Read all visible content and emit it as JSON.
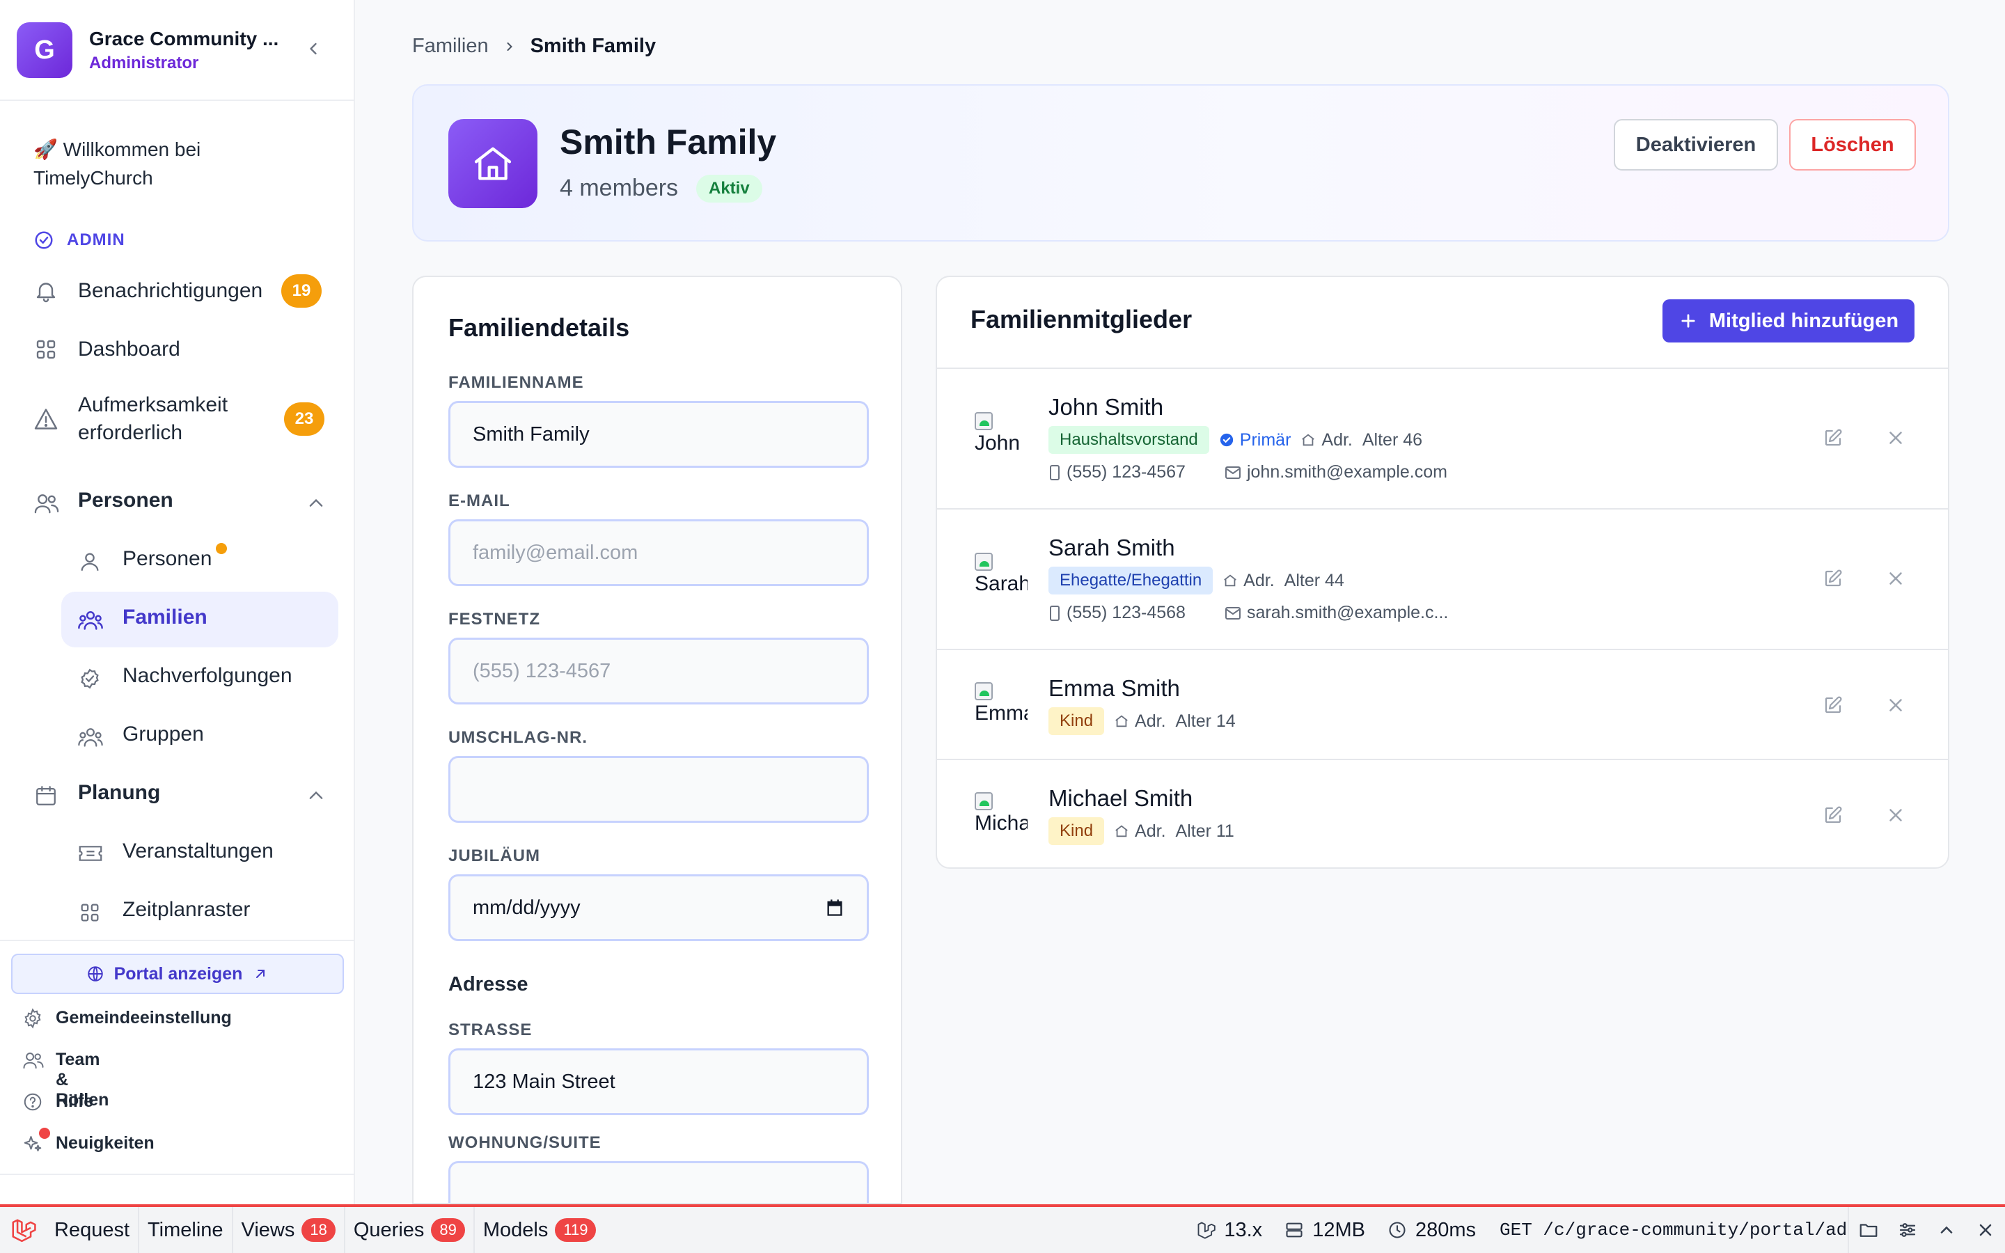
{
  "sidebar": {
    "org_initial": "G",
    "org_name": "Grace Community ...",
    "org_role": "Administrator",
    "welcome": "🚀 Willkommen bei TimelyChurch",
    "section_admin": "ADMIN",
    "notifications": {
      "label": "Benachrichtigungen",
      "count": "19"
    },
    "dashboard": "Dashboard",
    "attention": {
      "label": "Aufmerksamkeit erforderlich",
      "count": "23"
    },
    "personen_group": "Personen",
    "personen_items": [
      "Personen",
      "Familien",
      "Nachverfolgungen",
      "Gruppen"
    ],
    "planung_group": "Planung",
    "planung_items": [
      "Veranstaltungen",
      "Zeitplanraster"
    ],
    "portal_button": "Portal anzeigen",
    "footer": [
      "Gemeindeeinstellung",
      "Team & Rollen",
      "Hilfe",
      "Neuigkeiten"
    ]
  },
  "breadcrumb": {
    "parent": "Familien",
    "current": "Smith Family"
  },
  "header": {
    "title": "Smith Family",
    "members": "4 members",
    "status": "Aktiv",
    "deactivate": "Deaktivieren",
    "delete": "Löschen"
  },
  "details": {
    "title": "Familiendetails",
    "family_name_label": "FAMILIENNAME",
    "family_name_value": "Smith Family",
    "email_label": "E-MAIL",
    "email_placeholder": "family@email.com",
    "phone_label": "FESTNETZ",
    "phone_placeholder": "(555) 123-4567",
    "envelope_label": "UMSCHLAG-NR.",
    "anniversary_label": "JUBILÄUM",
    "anniversary_placeholder": "mm/dd/yyyy",
    "address_heading": "Adresse",
    "street_label": "STRASSE",
    "street_value": "123 Main Street",
    "suite_label": "WOHNUNG/SUITE"
  },
  "members_panel": {
    "title": "Familienmitglieder",
    "add_button": "Mitglied hinzufügen",
    "members": [
      {
        "name": "John Smith",
        "alt": "John",
        "role": "Haushaltsvorstand",
        "primary": "Primär",
        "addr": "Adr.",
        "age": "Alter 46",
        "phone": "(555) 123-4567",
        "email": "john.smith@example.com"
      },
      {
        "name": "Sarah Smith",
        "alt": "Sarah",
        "role": "Ehegatte/Ehegattin",
        "addr": "Adr.",
        "age": "Alter 44",
        "phone": "(555) 123-4568",
        "email": "sarah.smith@example.c..."
      },
      {
        "name": "Emma Smith",
        "alt": "Emma",
        "role": "Kind",
        "addr": "Adr.",
        "age": "Alter 14"
      },
      {
        "name": "Michael Smith",
        "alt": "Michael",
        "role": "Kind",
        "addr": "Adr.",
        "age": "Alter 11"
      }
    ]
  },
  "debugbar": {
    "tabs": [
      {
        "label": "Request"
      },
      {
        "label": "Timeline"
      },
      {
        "label": "Views",
        "count": "18"
      },
      {
        "label": "Queries",
        "count": "89"
      },
      {
        "label": "Models",
        "count": "119"
      }
    ],
    "version": "13.x",
    "memory": "12MB",
    "time": "280ms",
    "route": "GET /c/grace-community/portal/admin/families"
  },
  "colors": {
    "accent": "#4f46e5",
    "brand": "#7c3aed",
    "badge": "#f59e0b",
    "danger": "#dc2626",
    "debug": "#ef4444"
  }
}
